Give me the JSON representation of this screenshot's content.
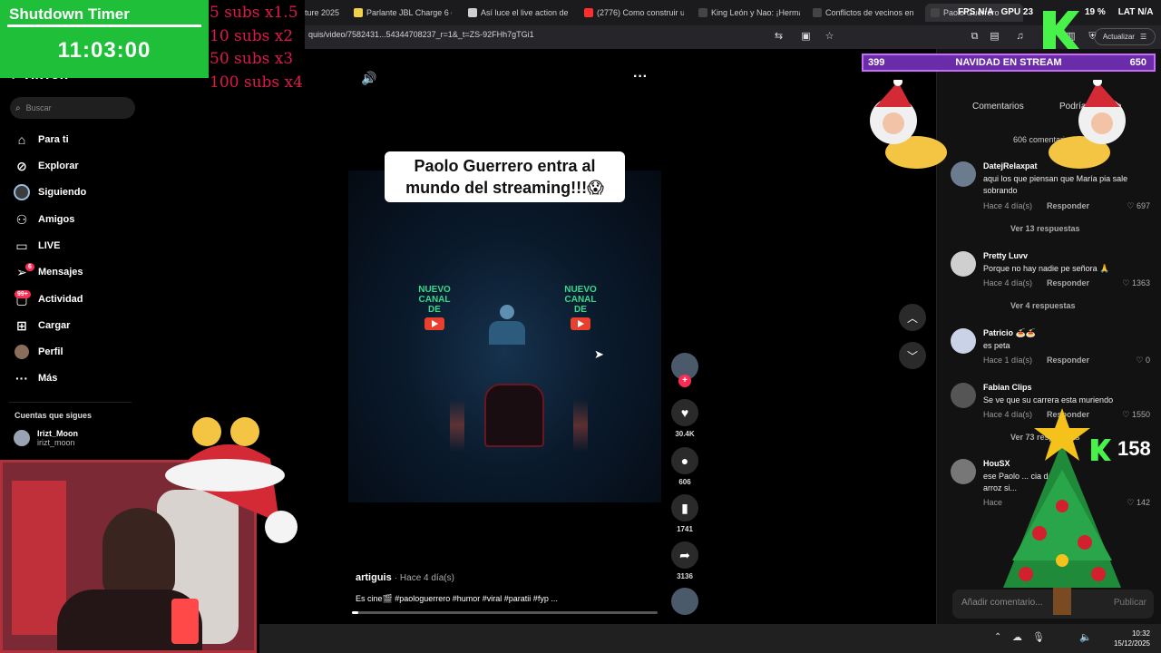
{
  "browser": {
    "tabs": [
      {
        "label": "ture 2025",
        "color": "#555"
      },
      {
        "label": "Parlante JBL Charge 6 colo",
        "color": "#f2d14a"
      },
      {
        "label": "Así luce el live action de 'A",
        "color": "#cfcfcf"
      },
      {
        "label": "(2776) Como construir un",
        "color": "#ff2d2d"
      },
      {
        "label": "King León y Nao: ¡Herman",
        "color": "#111"
      },
      {
        "label": "Conflictos de vecinos en",
        "color": "#111"
      },
      {
        "label": "Paolo Guerrero",
        "color": "#111"
      }
    ],
    "url": "quis/video/7582431...54344708237_r=1&_t=ZS-92FHh7gTGi1",
    "update_label": "Actualizar"
  },
  "hud": {
    "fps_label": "FPS",
    "fps_value": "N/A",
    "gpu_label": "GPU",
    "gpu_value": "23",
    "cpu_value": "19 %",
    "lat_label": "LAT",
    "lat_value": "N/A"
  },
  "overlay": {
    "timer_title": "Shutdown Timer",
    "timer_value": "11:03:00",
    "subs": [
      "5 subs x1.5",
      "10 subs x2",
      "50 subs x3",
      "100 subs x4"
    ],
    "goal_left": "399",
    "goal_title": "NAVIDAD EN STREAM",
    "goal_right": "650",
    "follower_count": "158",
    "colors": {
      "timer_bg": "#1fbf3a",
      "subs_text": "#e0184a",
      "goal_bg": "#6a2ca8",
      "kick_green": "#49f24b"
    }
  },
  "sidebar": {
    "search_placeholder": "Buscar",
    "items": [
      {
        "label": "Para ti",
        "icon": "home-icon"
      },
      {
        "label": "Explorar",
        "icon": "compass-icon"
      },
      {
        "label": "Siguiendo",
        "icon": "following-icon"
      },
      {
        "label": "Amigos",
        "icon": "friends-icon"
      },
      {
        "label": "LIVE",
        "icon": "live-icon"
      },
      {
        "label": "Mensajes",
        "icon": "send-icon",
        "badge": "6"
      },
      {
        "label": "Actividad",
        "icon": "activity-icon",
        "badge": "99+"
      },
      {
        "label": "Cargar",
        "icon": "upload-icon"
      },
      {
        "label": "Perfil",
        "icon": "profile-icon"
      },
      {
        "label": "Más",
        "icon": "more-icon"
      }
    ],
    "following_title": "Cuentas que sigues",
    "following": [
      {
        "name": "Irizt_Moon",
        "handle": "irizt_moon"
      }
    ]
  },
  "video": {
    "caption_line1": "Paolo Guerrero entra al",
    "caption_line2": "mundo del streaming!!!😱",
    "sign_text": "NUEVO\nCANAL\nDE",
    "author": "artiguis",
    "posted": "· Hace 4 día(s)",
    "description": "Es cine🎬 #paologuerrero #humor #viral #paratii #fyp ...",
    "likes": "30.4K",
    "comments": "606",
    "saves": "1741",
    "shares": "3136",
    "progress": 0.02
  },
  "comments_panel": {
    "tab_comments": "Comentarios",
    "tab_creators": "Podría gustarte",
    "count": "606 comentarios",
    "reply_label": "Responder",
    "items": [
      {
        "name": "DatejRelaxpat",
        "text": "aqui los que piensan que María pia sale sobrando",
        "meta": "Hace 4 día(s)",
        "likes": "697",
        "replies": "Ver 13 respuestas"
      },
      {
        "name": "Pretty Luvv",
        "text": "Porque no hay nadie pe señora 🙏",
        "meta": "Hace 4 día(s)",
        "likes": "1363",
        "replies": "Ver 4 respuestas"
      },
      {
        "name": "Patricio 🍝🍝",
        "text": "es peta",
        "meta": "Hace 1 día(s)",
        "likes": "0",
        "replies": ""
      },
      {
        "name": "Fabian Clips",
        "text": "Se ve que su carrera esta muriendo",
        "meta": "Hace 4 día(s)",
        "likes": "1550",
        "replies": "Ver 73 respuestas"
      },
      {
        "name": "HouSX",
        "text": "ese Paolo ... cia de un arroz si...",
        "meta": "Hace",
        "likes": "142",
        "replies": ""
      }
    ],
    "add_placeholder": "Añadir comentario...",
    "post_label": "Publicar"
  },
  "taskbar": {
    "time": "10:32",
    "date": "15/12/2025"
  }
}
